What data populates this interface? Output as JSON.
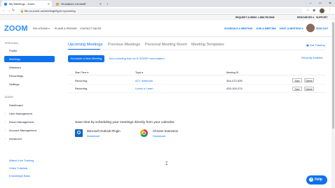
{
  "browser": {
    "tabs": [
      {
        "title": "My Meetings - Zoom",
        "favicon_color": "#2d8cff"
      },
      {
        "title": "Grundkurs Lernstoff",
        "favicon_color": "#e8a33c"
      }
    ],
    "new_tab": "+",
    "url": "file.us.zoom.us/meeting#/type=upcoming",
    "window_controls": {
      "minimize": "–",
      "maximize": "□",
      "close": "✕"
    }
  },
  "utility_bar": {
    "request_demo": "REQUEST A DEMO",
    "phone": "1.888.799.5926",
    "resources": "RESOURCES ▾",
    "support": "SUPPORT"
  },
  "header": {
    "logo": "ZOOM",
    "nav": [
      "SOLUTIONS ▾",
      "PLANS & PRICING",
      "CONTACT SALES"
    ],
    "right": [
      "SCHEDULE A MEETING",
      "JOIN A MEETING",
      "HOST A MEETING ▾",
      "SIGN OUT"
    ]
  },
  "sidebar": {
    "personal_heading": "PERSONAL",
    "personal_items": [
      "Profile",
      "Meetings",
      "Webinars",
      "Recordings",
      "Settings"
    ],
    "selected": "Meetings",
    "admin_heading": "ADMIN",
    "admin_items": [
      "Dashboard",
      "User Management",
      "Room Management",
      "Account Management",
      "Advanced"
    ],
    "links": [
      "Attend Live Training",
      "Video Tutorials",
      "Knowledge Base"
    ]
  },
  "main": {
    "tabs": [
      "Upcoming Meetings",
      "Previous Meetings",
      "Personal Meeting Room",
      "Meeting Templates"
    ],
    "active_tab": "Upcoming Meetings",
    "get_training": "Get Training",
    "recently_deleted": "Recently Deleted",
    "schedule_button": "Schedule a New Meeting",
    "start_h323": "Join a meeting from an H.323/SIP room system",
    "columns": [
      "Start Time ▾",
      "Topic ▾",
      "Meeting ID"
    ],
    "rows": [
      {
        "start": "Recurring",
        "topic": "ACT webinars",
        "id": "304-472-539",
        "start_btn": "Start",
        "delete_btn": "Delete"
      },
      {
        "start": "Recurring",
        "topic": "Lunch n Learn",
        "id": "433-109-374",
        "start_btn": "Start",
        "delete_btn": "Delete"
      }
    ],
    "save_time": "Save time by scheduling your meetings directly from your calendar.",
    "plugins": [
      {
        "title": "Microsoft Outlook Plugin",
        "link": "Download"
      },
      {
        "title": "Chrome Extension",
        "link": "Download"
      }
    ]
  },
  "help_button": "Help"
}
